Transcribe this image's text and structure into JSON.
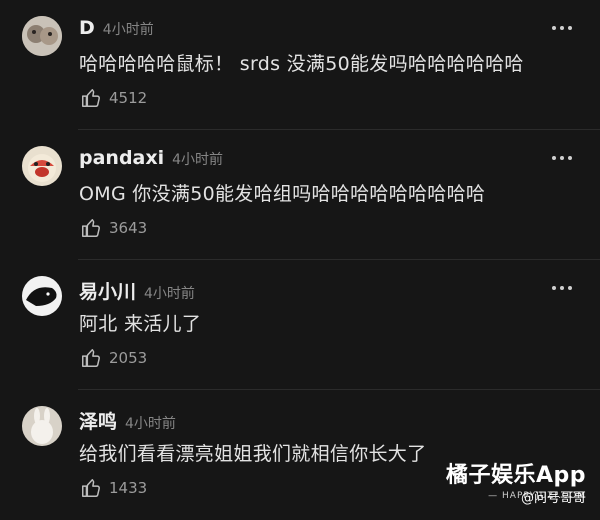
{
  "comments": [
    {
      "user": "D",
      "time": "4小时前",
      "text": "哈哈哈哈哈鼠标！ srds 没满50能发吗哈哈哈哈哈哈",
      "likes": "4512"
    },
    {
      "user": "pandaxi",
      "time": "4小时前",
      "text": "OMG 你没满50能发哈组吗哈哈哈哈哈哈哈哈哈",
      "likes": "3643"
    },
    {
      "user": "易小川",
      "time": "4小时前",
      "text": "阿北 来活儿了",
      "likes": "2053"
    },
    {
      "user": "泽鸣",
      "time": "4小时前",
      "text": "给我们看看漂亮姐姐我们就相信你长大了",
      "likes": "1433"
    }
  ],
  "watermark": {
    "app": "橘子娱乐App",
    "domain": "— HAPPYJUZI.COM",
    "weibo": "@问号哥哥"
  },
  "colors": {
    "background": "#161616",
    "text": "#e2e2e2",
    "muted": "#858585"
  }
}
